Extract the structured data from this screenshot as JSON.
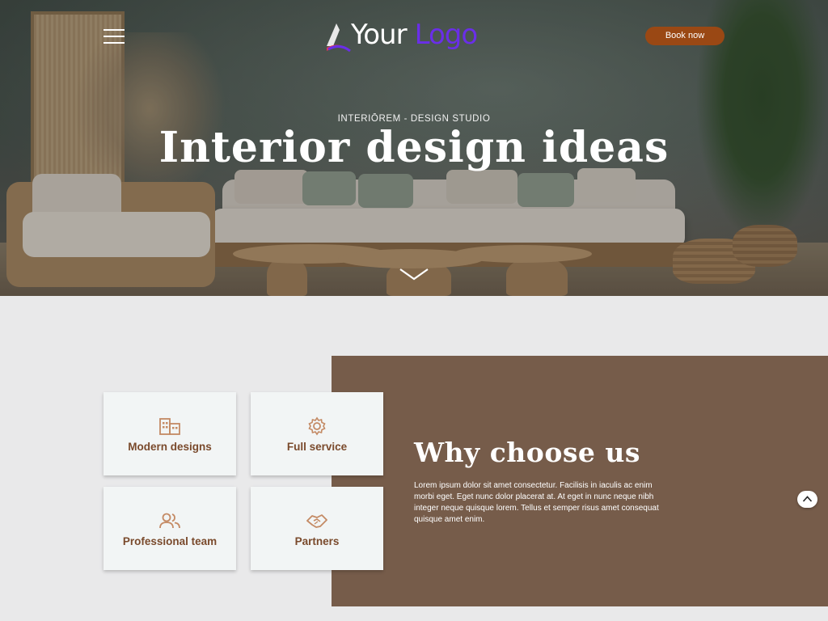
{
  "header": {
    "menu_icon": "hamburger-menu-icon",
    "logo": {
      "word1": "Your",
      "word2": "Logo",
      "colors": {
        "primary": "#6a2ee8",
        "accent": "#e0325a"
      }
    },
    "book_button": "Book now",
    "book_button_color": "#9a4814"
  },
  "hero": {
    "eyebrow": "INTERIŌREM - DESIGN STUDIO",
    "title": "Interior design ideas",
    "scroll_icon": "chevron-down-icon"
  },
  "features": [
    {
      "label": "Modern designs",
      "icon": "building-icon"
    },
    {
      "label": "Full service",
      "icon": "gear-icon"
    },
    {
      "label": "Professional team",
      "icon": "users-icon"
    },
    {
      "label": "Partners",
      "icon": "handshake-icon"
    }
  ],
  "why": {
    "title": "Why choose us",
    "text": "Lorem ipsum dolor sit amet consectetur. Facilisis in iaculis ac enim morbi eget. Eget nunc dolor placerat at. At eget in nunc neque nibh integer neque quisque lorem. Tellus et semper risus amet consequat quisque amet enim.",
    "panel_color": "#765c4a"
  },
  "scroll_top_icon": "chevron-up-icon"
}
